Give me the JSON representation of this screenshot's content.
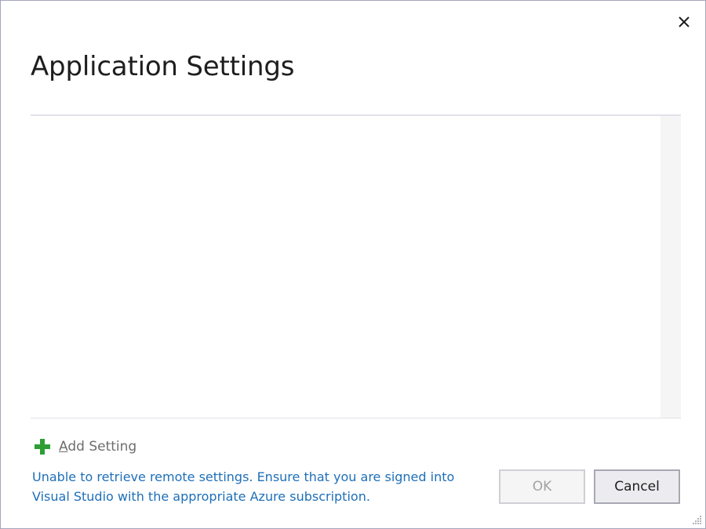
{
  "dialog": {
    "title": "Application Settings",
    "close_icon": "close-icon"
  },
  "settings_list": {
    "items": []
  },
  "add_setting": {
    "icon": "plus-icon",
    "mnemonic": "A",
    "label_rest": "dd Setting",
    "icon_color": "#2e9e34"
  },
  "status": {
    "message": "Unable to retrieve remote settings. Ensure that you are signed into Visual Studio with the appropriate Azure subscription.",
    "color": "#1e6fb8"
  },
  "buttons": {
    "ok_label": "OK",
    "ok_enabled": false,
    "cancel_label": "Cancel"
  }
}
